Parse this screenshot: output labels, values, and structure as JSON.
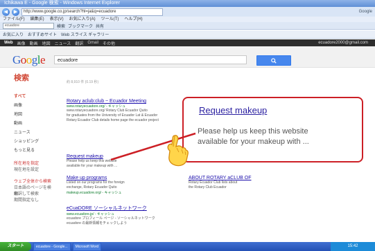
{
  "window": {
    "title": "Ichikawa E - Google 検索 - Windows Internet Explorer"
  },
  "nav": {
    "address": "http://www.google.co.jp/search?hl=ja&q=ecuadore",
    "right_text": "Google"
  },
  "menu": [
    "ファイル(F)",
    "編集(E)",
    "表示(V)",
    "お気に入り(A)",
    "ツール(T)",
    "ヘルプ(H)"
  ],
  "toolbar": {
    "search_value": "ecuadore",
    "items": [
      "検索",
      "ブックマーク",
      "共有"
    ]
  },
  "favbar": [
    "お気に入り",
    "おすすめサイト",
    "Web スライス ギャラリー"
  ],
  "gbar": {
    "items": [
      "Web",
      "画像",
      "動画",
      "地図",
      "ニュース",
      "翻訳",
      "Gmail",
      "その他"
    ],
    "user": "ecuadore2000@gmail.com"
  },
  "search": {
    "query": "ecuadore",
    "button_label": "Q"
  },
  "logo_letters": [
    "G",
    "o",
    "o",
    "g",
    "l",
    "e"
  ],
  "sidebar": {
    "title": "検索",
    "items": [
      "すべて",
      "画像",
      "地図",
      "動画",
      "ニュース",
      "ショッピング",
      "もっと見る"
    ],
    "location_lines": [
      "所在地を指定",
      "現在地を設定"
    ],
    "options_lines": [
      "ウェブ全体から検索",
      "日本語のページを検索",
      "翻訳して検索"
    ],
    "more": "期間指定なし"
  },
  "stats": "約 8,910 件 (0.19 秒)",
  "results": [
    {
      "title": "Rotary aclub:club ~ Ecuador Meeting",
      "url": "www.rotaryecuadore.org/ - キャッシュ",
      "snippet": [
        "www.rotaryecuadore.org/ Rotary Club Ecuador Quito",
        "for graduates from the University of Ecuador Lat & Ecuador",
        "Rotary Ecuador Club details home page the ecuador project"
      ]
    },
    {
      "title": "Request makeup",
      "url": "",
      "snippet": [
        "Please help us keep this website",
        "available for your makeup with ..."
      ]
    },
    {
      "title": "Make up programs",
      "url": "makeup.ecuadore.org/ - キャッシュ",
      "snippet": [
        "Listed on our programs for the foreign",
        "exchange, Rotary Ecuador Quito"
      ]
    },
    {
      "title": "ABOUT ROTARY aCLUB OF",
      "url": "",
      "snippet": [
        "Rotary Ecuador Club lists about",
        "the Rotary Club Ecuador"
      ]
    },
    {
      "title": "eCuaDORE ソーシャルネットワーク",
      "url": "www.ecuadore.jp/ - キャッシュ",
      "snippet": [
        "ecuadore プロフィール ページ - ソーシャルネットワーク",
        "ecuadore の最新情報をチェックしよう"
      ]
    }
  ],
  "callout": {
    "title": "Request makeup",
    "body_lines": [
      "Please help us keep this website",
      "available for your makeup with ..."
    ]
  },
  "taskbar": {
    "start": "スタート",
    "tasks": [
      "ecuadore - Google...",
      "Microsoft Word"
    ],
    "clock": "15:42"
  }
}
